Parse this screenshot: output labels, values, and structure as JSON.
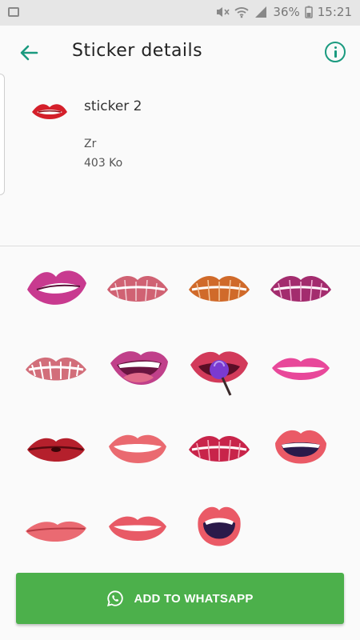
{
  "status_bar": {
    "battery": "36%",
    "time": "15:21"
  },
  "app_bar": {
    "title": "Sticker details",
    "back_icon": "arrow-back-icon",
    "info_icon": "info-icon"
  },
  "sticker": {
    "name": "sticker 2",
    "author": "Zr",
    "size": "403 Ko"
  },
  "stickers_grid": [
    "lips-biting",
    "kiss-print-red",
    "kiss-print-orange",
    "kiss-print-purple",
    "kiss-print-faded",
    "lips-open-tongue",
    "lips-lollipop",
    "lips-smile-pink",
    "lips-closed-red",
    "lips-smile-coral",
    "kiss-print-magenta",
    "lips-open-dark",
    "lips-pout",
    "lips-teeth-smile",
    "lips-wide-open"
  ],
  "add_button": {
    "label": "ADD TO WHATSAPP",
    "icon": "whatsapp-icon"
  },
  "colors": {
    "accent": "#1a9a7f",
    "button": "#4cb04b"
  }
}
